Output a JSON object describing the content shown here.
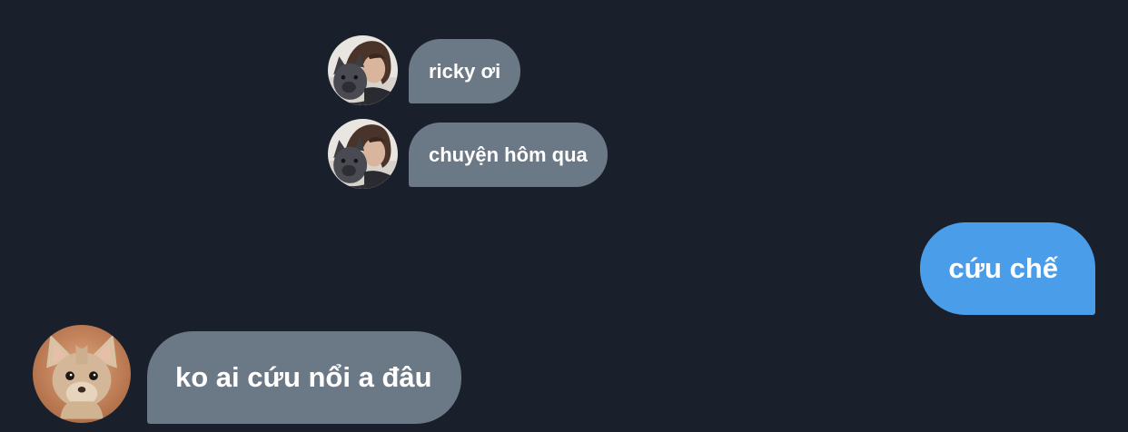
{
  "conversation": {
    "messages": [
      {
        "sender": "ricky-friend",
        "direction": "incoming",
        "text": "ricky ơi",
        "avatar_icon": "person-with-dog-avatar-icon"
      },
      {
        "sender": "ricky-friend",
        "direction": "incoming",
        "text": "chuyện hôm qua",
        "avatar_icon": "person-with-dog-avatar-icon"
      },
      {
        "sender": "me",
        "direction": "outgoing",
        "text": "cứu chế"
      },
      {
        "sender": "ricky",
        "direction": "incoming",
        "text": "ko ai cứu nổi a đâu",
        "avatar_icon": "chihuahua-avatar-icon"
      }
    ]
  },
  "colors": {
    "background": "#1a202b",
    "incoming_bubble": "#6b7885",
    "outgoing_bubble": "#4a9de9",
    "text": "#ffffff"
  }
}
